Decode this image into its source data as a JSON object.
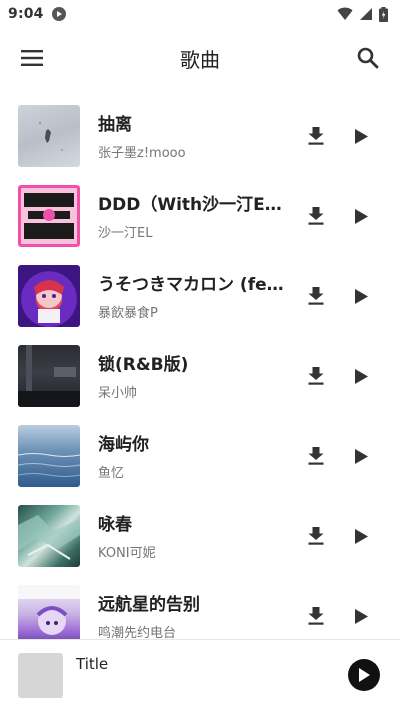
{
  "status_bar": {
    "time": "9:04"
  },
  "app_bar": {
    "title": "歌曲"
  },
  "songs": [
    {
      "title": "抽离",
      "artist": "张子墨z!mooo"
    },
    {
      "title": "DDD（With沙一汀EL）",
      "artist": "沙一汀EL"
    },
    {
      "title": "うそつきマカロン (feat. ...",
      "artist": "暴飲暴食P"
    },
    {
      "title": "锁(R&B版)",
      "artist": "呆小帅"
    },
    {
      "title": "海屿你",
      "artist": "鱼忆"
    },
    {
      "title": "咏春",
      "artist": "KONI可妮"
    },
    {
      "title": "远航星的告别",
      "artist": "鸣潮先约电台"
    }
  ],
  "mini_player": {
    "title": "Title"
  },
  "colors": {
    "background": "#ffffff",
    "primary_text": "#212121",
    "secondary_text": "#757575",
    "icon": "#333333"
  }
}
